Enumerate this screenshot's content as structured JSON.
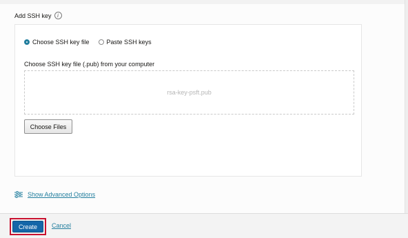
{
  "section": {
    "title": "Add SSH key",
    "info_icon": "i"
  },
  "key_source": {
    "options": [
      {
        "label": "Choose SSH key file",
        "selected": true
      },
      {
        "label": "Paste SSH keys",
        "selected": false
      }
    ]
  },
  "file_field": {
    "label": "Choose SSH key file (.pub) from your computer",
    "selected_file": "rsa-key-psft.pub",
    "choose_button": "Choose Files"
  },
  "advanced": {
    "icon": "sliders-icon",
    "link_label": "Show Advanced Options"
  },
  "footer": {
    "create_label": "Create",
    "cancel_label": "Cancel"
  },
  "colors": {
    "accent": "#227e9e",
    "primary_button": "#1466a8",
    "highlight_box": "#c8102e"
  }
}
